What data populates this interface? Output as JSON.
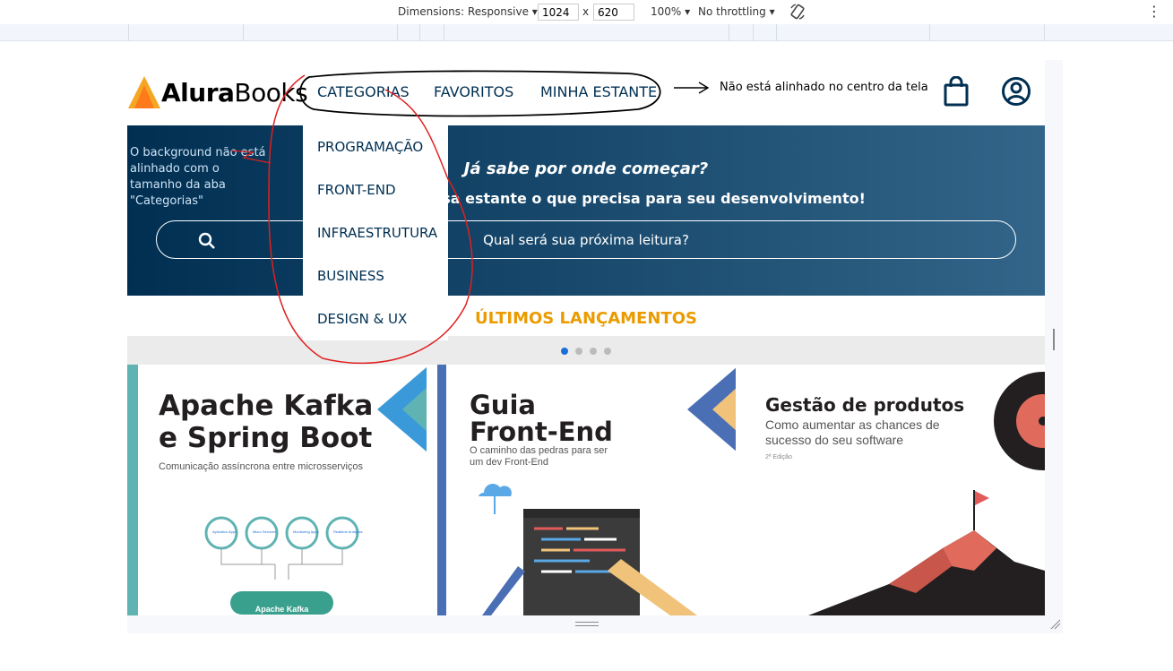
{
  "devtools": {
    "dimensions_label": "Dimensions: Responsive",
    "width": "1024",
    "times": "x",
    "height": "620",
    "zoom": "100%",
    "throttling": "No throttling"
  },
  "site": {
    "logo_bold": "Alura",
    "logo_regular": "Books",
    "nav": {
      "categories": "CATEGORIAS",
      "favorites": "FAVORITOS",
      "shelf": "MINHA ESTANTE"
    },
    "dropdown": [
      "PROGRAMAÇÃO",
      "FRONT-END",
      "INFRAESTRUTURA",
      "BUSINESS",
      "DESIGN & UX"
    ],
    "banner": {
      "title": "Já sabe por onde começar?",
      "subtitle": "Encontre em nossa estante o que precisa para seu desenvolvimento!",
      "search_placeholder": "Qual será sua próxima leitura?"
    },
    "section_title": "ÚLTIMOS LANÇAMENTOS",
    "carousel": {
      "dots": 4,
      "active": 1
    },
    "books": [
      {
        "title_line1": "Apache Kafka",
        "title_line2": "e Spring Boot",
        "subtitle": "Comunicação assíncrona entre microsserviços",
        "badge": "Apache Kafka",
        "nodes": [
          "Aplicativo Apps",
          "Micro Services",
          "Monitoring Apps",
          "Realtime Analytics"
        ]
      },
      {
        "title_line1": "Guia",
        "title_line2": "Front-End",
        "subtitle_line1": "O caminho das pedras para ser",
        "subtitle_line2": "um dev Front-End"
      },
      {
        "title": "Gestão de produtos",
        "subtitle_line1": "Como aumentar as chances de",
        "subtitle_line2": "sucesso do seu software",
        "edition": "2ª Edição"
      }
    ]
  },
  "annotations": {
    "arrow_note": "Não está alinhado no centro da tela",
    "bg_note": [
      "O background não está",
      "alinhado com o",
      "tamanho da aba",
      "\"Categorias\""
    ]
  },
  "colors": {
    "brand": "#002f52",
    "accent": "#eb9b00",
    "logo_orange": "#f5a623",
    "annotation_red": "#e02020"
  }
}
